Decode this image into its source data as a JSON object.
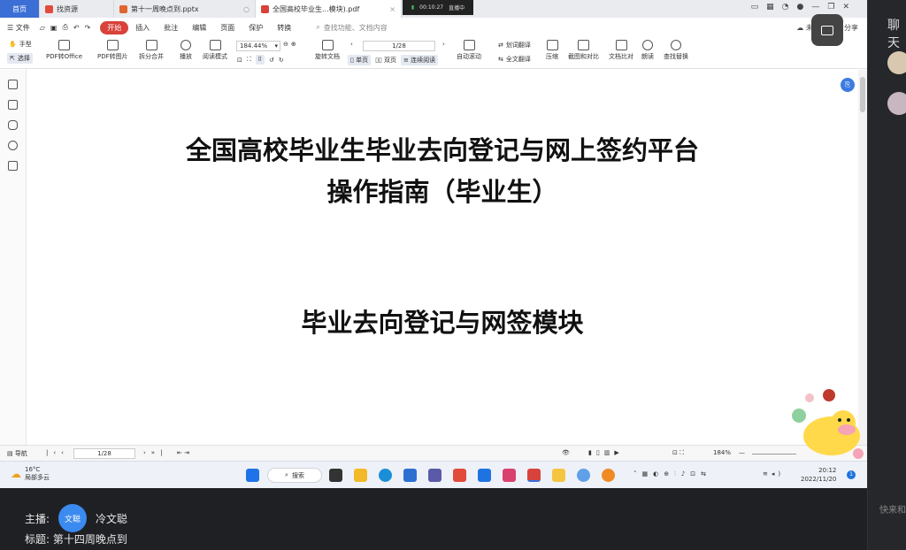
{
  "tabs": [
    {
      "label": "首页"
    },
    {
      "label": "找资源",
      "color": "#e24a3b"
    },
    {
      "label": "第十一周晚点到.pptx",
      "color": "#e0652f"
    },
    {
      "label": "全国高校毕业生...模块).pdf",
      "color": "#d9423a"
    }
  ],
  "timer": {
    "time": "00:10:27",
    "status": "直播中"
  },
  "menu": {
    "file": "文件",
    "items": [
      "开始",
      "插入",
      "批注",
      "编辑",
      "页面",
      "保护",
      "转换"
    ],
    "search_hint": "查找功能、文档内容",
    "sync": "未同步",
    "share": "分享"
  },
  "toolbar": {
    "hand": "手型",
    "select": "选择",
    "pdf_to_office": "PDF转Office",
    "pdf_to_image": "PDF转图片",
    "split_merge": "拆分合并",
    "play": "播放",
    "read_mode": "阅读模式",
    "zoom": "184.44%",
    "page": "1/28",
    "rotate": "旋转文档",
    "single": "单页",
    "double": "双页",
    "continuous": "连续阅读",
    "auto_scroll": "自动滚动",
    "word_translate": "划词翻译",
    "full_translate": "全文翻译",
    "compress": "压缩",
    "screenshot": "截图和对比",
    "doc_compare": "文档比对",
    "read_aloud": "朗读",
    "find_replace": "查找替换"
  },
  "document": {
    "title_line1": "全国高校毕业生毕业去向登记与网上签约平台",
    "title_line2": "操作指南（毕业生）",
    "subtitle": "毕业去向登记与网签模块"
  },
  "statusbar": {
    "nav": "导航",
    "page": "1/28",
    "zoom": "184%"
  },
  "taskbar": {
    "temp": "16°C",
    "weather": "局部多云",
    "search": "搜索",
    "time": "20:12",
    "date": "2022/11/20",
    "badge": "1"
  },
  "stream": {
    "host_label": "主播:",
    "host_avatar": "文聪",
    "host_name": "冷文聪",
    "title_label": "标题:",
    "title": "第十四周晚点到"
  },
  "right_pane": {
    "chat": "聊天",
    "input_hint": "快来和"
  }
}
